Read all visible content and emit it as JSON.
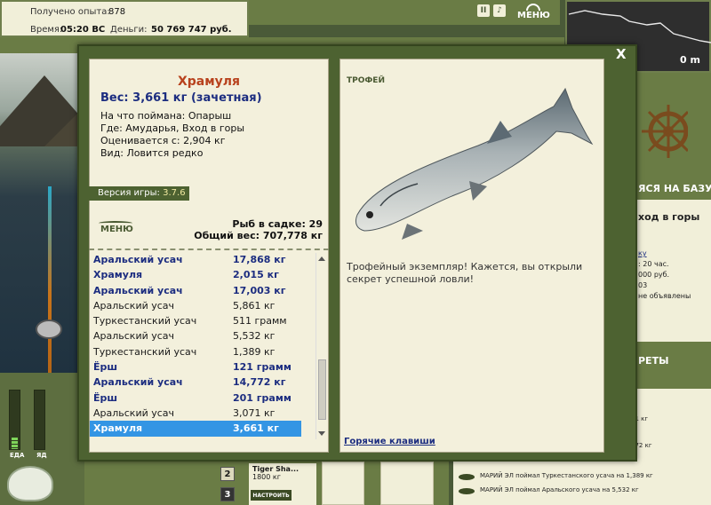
{
  "hud": {
    "exp_label": "Получено опыта:",
    "exp_value": "878",
    "time_label": "Время:",
    "time_value": "05:20 ВС",
    "money_label": "Деньги:",
    "money_value": "50 769 747 руб.",
    "menu_label": "МЕНЮ",
    "depth_value": "0 m"
  },
  "side": {
    "base_label": "ЯСЯ НА БАЗУ",
    "place": "ход в горы",
    "link": "ку",
    "line1": ": 20 час.",
    "line2": "000 руб.",
    "line3": "03",
    "line4": "не объявлены",
    "secrets": "РЕТЫ",
    "meter1_label": "ЕДА",
    "meter2_label": "ЯД"
  },
  "log": {
    "rows": [
      "71 кг",
      "772 кг",
      "МАРИЙ ЭЛ поймал Туркестанского усача на 1,389 кг",
      "МАРИЙ ЭЛ поймал Аральского усача на 5,532 кг"
    ]
  },
  "bottom": {
    "slot2": "2",
    "slot3": "3",
    "tackle_name": "Tiger Sha...",
    "tackle_len": "1800 кг",
    "setup_button": "НАСТРОИТЬ"
  },
  "dialog": {
    "fish_name": "Храмуля",
    "weight_line": "Вес: 3,661 кг (зачетная)",
    "bait_line": "На что поймана: Опарыш",
    "place_line": "Где: Амударья, Вход в горы",
    "price_line": "Оценивается с: 2,904 кг",
    "kind_line": "Вид: Ловится редко",
    "version_label": "Версия игры:",
    "version_value": "3.7.6",
    "menu_label": "МЕНЮ",
    "keep_count": "Рыб в садке: 29",
    "keep_weight": "Общий вес: 707,778 кг",
    "catch_list": [
      {
        "name": "Аральский усач",
        "weight": "17,868 кг",
        "bold": true
      },
      {
        "name": "Храмуля",
        "weight": "2,015 кг",
        "bold": true
      },
      {
        "name": "Аральский усач",
        "weight": "17,003 кг",
        "bold": true
      },
      {
        "name": "Аральский усач",
        "weight": "5,861 кг",
        "bold": false
      },
      {
        "name": "Туркестанский усач",
        "weight": "511 грамм",
        "bold": false
      },
      {
        "name": "Аральский усач",
        "weight": "5,532 кг",
        "bold": false
      },
      {
        "name": "Туркестанский усач",
        "weight": "1,389 кг",
        "bold": false
      },
      {
        "name": "Ёрш",
        "weight": "121 грамм",
        "bold": true
      },
      {
        "name": "Аральский усач",
        "weight": "14,772 кг",
        "bold": true
      },
      {
        "name": "Ёрш",
        "weight": "201 грамм",
        "bold": true
      },
      {
        "name": "Аральский усач",
        "weight": "3,071 кг",
        "bold": false
      },
      {
        "name": "Храмуля",
        "weight": "3,661 кг",
        "bold": true,
        "selected": true
      }
    ],
    "trophy_label": "ТРОФЕЙ",
    "trophy_text": "Трофейный экземпляр! Кажется, вы открыли секрет успешной ловли!",
    "hotkeys_link": "Горячие клавиши",
    "close": "X"
  },
  "colors": {
    "accent_green": "#4d6231",
    "fish_title": "#b8421d",
    "bold_blue": "#1c2d80",
    "selection": "#3395e4"
  }
}
